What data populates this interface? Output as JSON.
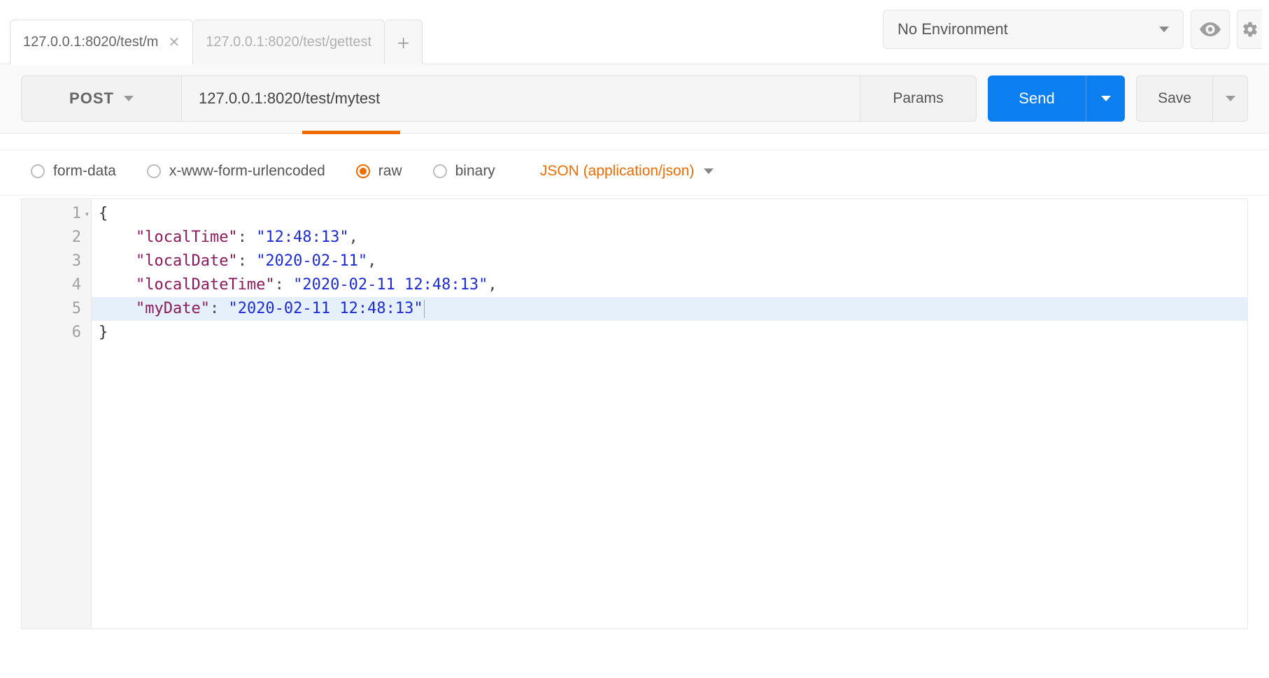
{
  "topbar": {
    "tabs": [
      {
        "label": "127.0.0.1:8020/test/m",
        "active": true
      },
      {
        "label": "127.0.0.1:8020/test/gettest",
        "active": false
      }
    ],
    "env_label": "No Environment"
  },
  "request": {
    "method": "POST",
    "url": "127.0.0.1:8020/test/mytest",
    "params_label": "Params",
    "send_label": "Send",
    "save_label": "Save"
  },
  "body": {
    "options": {
      "form_data": "form-data",
      "url_encoded": "x-www-form-urlencoded",
      "raw": "raw",
      "binary": "binary"
    },
    "selected": "raw",
    "content_type": "JSON (application/json)"
  },
  "editor": {
    "highlighted_line": 5,
    "lines": [
      {
        "n": 1,
        "fold": true,
        "tokens": [
          {
            "t": "brace",
            "v": "{"
          }
        ]
      },
      {
        "n": 2,
        "tokens": [
          {
            "t": "indent"
          },
          {
            "t": "key",
            "v": "\"localTime\""
          },
          {
            "t": "punc",
            "v": ": "
          },
          {
            "t": "str",
            "v": "\"12:48:13\""
          },
          {
            "t": "punc",
            "v": ","
          }
        ]
      },
      {
        "n": 3,
        "tokens": [
          {
            "t": "indent"
          },
          {
            "t": "key",
            "v": "\"localDate\""
          },
          {
            "t": "punc",
            "v": ": "
          },
          {
            "t": "str",
            "v": "\"2020-02-11\""
          },
          {
            "t": "punc",
            "v": ","
          }
        ]
      },
      {
        "n": 4,
        "tokens": [
          {
            "t": "indent"
          },
          {
            "t": "key",
            "v": "\"localDateTime\""
          },
          {
            "t": "punc",
            "v": ": "
          },
          {
            "t": "str",
            "v": "\"2020-02-11 12:48:13\""
          },
          {
            "t": "punc",
            "v": ","
          }
        ]
      },
      {
        "n": 5,
        "tokens": [
          {
            "t": "indent"
          },
          {
            "t": "key",
            "v": "\"myDate\""
          },
          {
            "t": "punc",
            "v": ": "
          },
          {
            "t": "str",
            "v": "\"2020-02-11 12:48:13\""
          },
          {
            "t": "cursor"
          }
        ]
      },
      {
        "n": 6,
        "tokens": [
          {
            "t": "brace",
            "v": "}"
          }
        ]
      }
    ]
  }
}
